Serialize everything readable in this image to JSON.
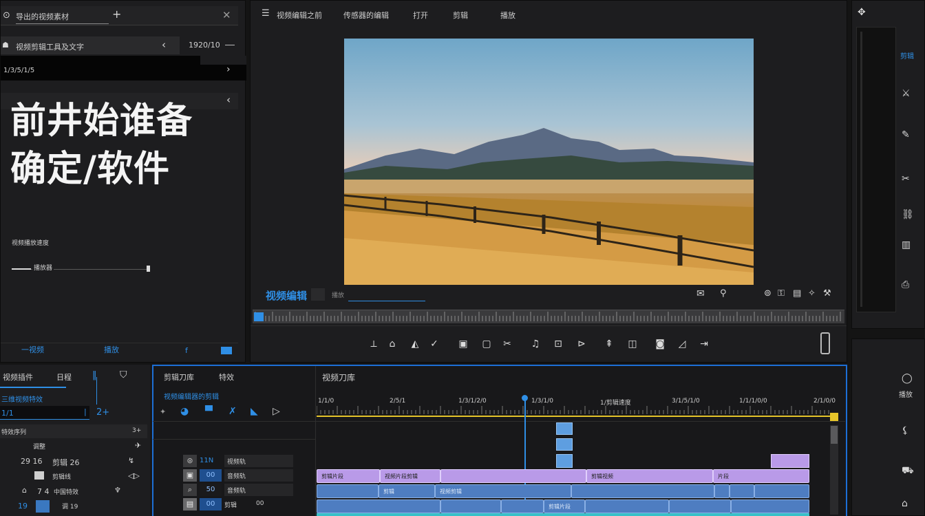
{
  "left_panel": {
    "tab_label": "导出的视频素材",
    "add_label": "+",
    "path_label": "视频剪辑工具及文字",
    "size_label": "1920/10",
    "search_label": "1/3/5/1/5",
    "title_text": "前井始谁备\n确定/软件",
    "info_label": "视频播放速度",
    "slider_label": "播放器",
    "bottom_items": [
      "一视频",
      "播放",
      "f",
      ""
    ]
  },
  "monitor": {
    "menu": [
      {
        "label": "视频编辑之前",
        "active": false
      },
      {
        "label": "传感器的编辑",
        "active": false
      },
      {
        "label": "打开",
        "active": false
      },
      {
        "label": "剪辑",
        "active": false
      },
      {
        "label": "播放",
        "active": true
      }
    ],
    "overlay_label": "视频编辑",
    "timecode_label": "播放",
    "playhead_progress": 0.01
  },
  "right_panel": {
    "label_top": "剪辑",
    "label_bottom": "播放"
  },
  "timeline": {
    "left_header": {
      "col1": "视频插件",
      "col2": "日程"
    },
    "left_rows": [
      {
        "a": "三维视频特效",
        "b": ""
      },
      {
        "a": "1/1",
        "b": "2+"
      },
      {
        "a": "特效序列",
        "b": "3+"
      },
      {
        "a": "",
        "b": "调整"
      },
      {
        "a": "29 16",
        "b": "剪辑  26"
      },
      {
        "a": "",
        "b": "剪辑线"
      },
      {
        "a": "7 4",
        "b": "中国特效"
      },
      {
        "a": "19",
        "b": "调  19"
      }
    ],
    "track_header": {
      "col1": "剪辑刀库",
      "col2": "特效"
    },
    "track_subtitle": "视频编辑器的剪辑",
    "tracks": [
      {
        "code": "11N",
        "name": "视频轨"
      },
      {
        "code": "00",
        "name": "音频轨"
      },
      {
        "code": "50",
        "name": "音频轨"
      },
      {
        "code": "00",
        "name": "剪辑",
        "extra": "00"
      }
    ],
    "panel_title": "视频刀库",
    "ruler": [
      "1/1/0",
      "2/5/1",
      "1/3/1/2/0",
      "1/3/1/0",
      "1/剪辑速度",
      "3/1/5/1/0",
      "1/1/1/0/0",
      "2/1/0/0"
    ],
    "clips": [
      {
        "label": "剪辑片段",
        "color": "purple"
      },
      {
        "label": "视频片段剪辑",
        "color": "purple"
      },
      {
        "label": "",
        "color": "purple"
      },
      {
        "label": "剪辑视频",
        "color": "purple"
      },
      {
        "label": "片段",
        "color": "purple"
      },
      {
        "label": "",
        "color": "blue"
      },
      {
        "label": "剪辑",
        "color": "blue"
      },
      {
        "label": "视频剪辑",
        "color": "blue"
      },
      {
        "label": "剪辑片段",
        "color": "blue"
      }
    ]
  }
}
